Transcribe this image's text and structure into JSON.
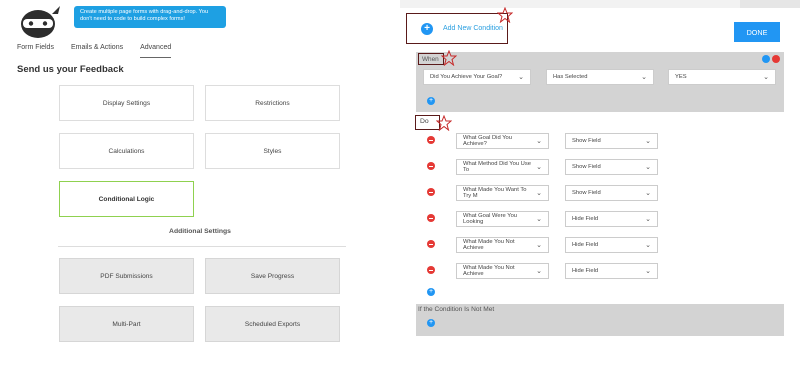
{
  "tooltip": {
    "text": "Create multiple page forms with drag-and-drop. You don't need to code to build complex forms!"
  },
  "tabs": [
    {
      "label": "Form Fields"
    },
    {
      "label": "Emails & Actions"
    },
    {
      "label": "Advanced"
    }
  ],
  "form_title": "Send us your Feedback",
  "settings_cards": [
    {
      "label": "Display Settings"
    },
    {
      "label": "Restrictions"
    },
    {
      "label": "Calculations"
    },
    {
      "label": "Styles"
    },
    {
      "label": "Conditional Logic"
    }
  ],
  "additional_settings": {
    "title": "Additional Settings",
    "cards": [
      {
        "label": "PDF Submissions"
      },
      {
        "label": "Save Progress"
      },
      {
        "label": "Multi-Part"
      },
      {
        "label": "Scheduled Exports"
      }
    ]
  },
  "toolbar": {
    "add_condition_label": "Add New Condition",
    "done_label": "DONE"
  },
  "when": {
    "label": "When",
    "field": "Did You Achieve Your Goal?",
    "operator": "Has Selected",
    "value": "YES"
  },
  "do": {
    "label": "Do",
    "rows": [
      {
        "field": "What Goal Did You Achieve?",
        "action": "Show Field"
      },
      {
        "field": "What Method Did You Use To",
        "action": "Show Field"
      },
      {
        "field": "What Made You Want To Try M",
        "action": "Show Field"
      },
      {
        "field": "What Goal Were You Looking",
        "action": "Hide Field"
      },
      {
        "field": "What Made You Not Achieve",
        "action": "Hide Field"
      },
      {
        "field": "What Made You Not Achieve",
        "action": "Hide Field"
      }
    ]
  },
  "else": {
    "label": "If the Condition Is Not Met"
  },
  "colors": {
    "accent": "#2196f3",
    "danger": "#e53935",
    "active_border": "#8fd14f",
    "highlight_box": "#5a1a1a"
  }
}
